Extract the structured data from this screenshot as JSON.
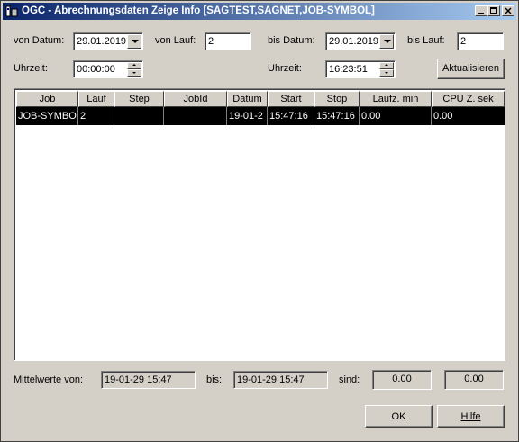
{
  "window": {
    "title": "OGC - Abrechnungsdaten Zeige Info [SAGTEST,SAGNET,JOB-SYMBOL]"
  },
  "filters": {
    "von_datum_label": "von Datum:",
    "von_datum": "29.01.2019",
    "von_lauf_label": "von Lauf:",
    "von_lauf": "2",
    "bis_datum_label": "bis Datum:",
    "bis_datum": "29.01.2019",
    "bis_lauf_label": "bis Lauf:",
    "bis_lauf": "2",
    "uhrzeit_von_label": "Uhrzeit:",
    "uhrzeit_von": "00:00:00",
    "uhrzeit_bis_label": "Uhrzeit:",
    "uhrzeit_bis": "16:23:51",
    "refresh_label": "Aktualisieren"
  },
  "table": {
    "columns": [
      "Job",
      "Lauf",
      "Step",
      "JobId",
      "Datum",
      "Start",
      "Stop",
      "Laufz. min",
      "CPU Z. sek"
    ],
    "rows": [
      [
        "JOB-SYMBO",
        "2",
        "",
        "",
        "19-01-2",
        "15:47:16",
        "15:47:16",
        "0.00",
        "0.00"
      ]
    ]
  },
  "summary": {
    "label": "Mittelwerte von:",
    "from": "19-01-29 15:47",
    "bis_label": "bis:",
    "to": "19-01-29 15:47",
    "sind_label": "sind:",
    "value1": "0.00",
    "value2": "0.00"
  },
  "buttons": {
    "ok": "OK",
    "hilfe": "Hilfe"
  }
}
